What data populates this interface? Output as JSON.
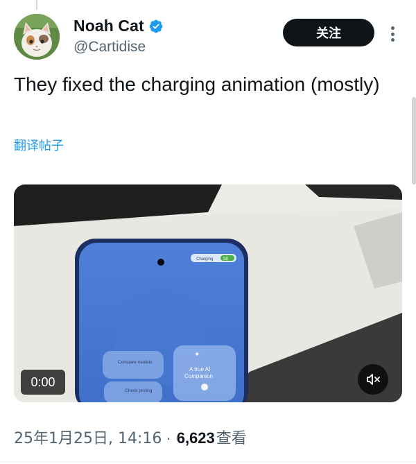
{
  "author": {
    "display_name": "Noah Cat",
    "handle": "@Cartidise",
    "verified": true,
    "avatar_icon": "cat-avatar"
  },
  "actions": {
    "follow_label": "关注",
    "more_icon": "more-vertical-icon"
  },
  "tweet": {
    "text": "They fixed the charging animation (mostly)",
    "translate_label": "翻译帖子"
  },
  "media": {
    "type": "video",
    "time": "0:00",
    "mute_icon": "speaker-muted-icon",
    "screen_text": {
      "status": "Charging",
      "battery": "38",
      "compare": "Compare models",
      "check": "Check pricing",
      "ai_line1": "A true AI",
      "ai_line2": "Companion"
    }
  },
  "meta": {
    "date": "25年1月25日, 14:16",
    "separator": "·",
    "views_count": "6,623",
    "views_label": "查看"
  },
  "colors": {
    "accent": "#1d9bf0",
    "follow_bg": "#0f1419",
    "secondary_text": "#536471"
  }
}
